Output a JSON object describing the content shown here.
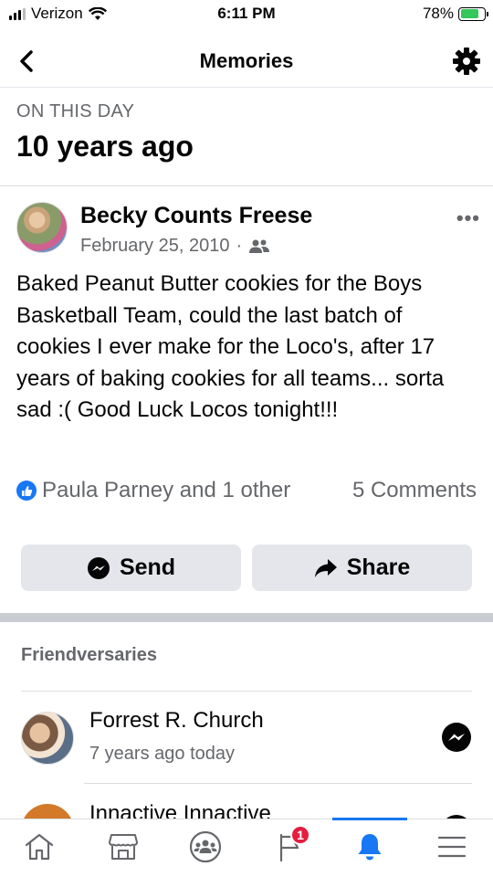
{
  "status_bar": {
    "carrier": "Verizon",
    "time": "6:11 PM",
    "battery": "78%"
  },
  "header": {
    "title": "Memories"
  },
  "on_this_day": {
    "label": "ON THIS DAY",
    "years_ago": "10 years ago"
  },
  "post": {
    "author": "Becky Counts Freese",
    "date": "February 25, 2010",
    "separator": "·",
    "text": "Baked Peanut Butter cookies for the Boys Basketball Team, could the last batch of cookies I ever make for the Loco's, after 17 years of baking cookies for all teams... sorta sad :( Good Luck Locos tonight!!!",
    "reactions_text": "Paula Parney and 1 other",
    "comments_text": "5 Comments",
    "send_label": "Send",
    "share_label": "Share"
  },
  "friendversaries": {
    "title": "Friendversaries",
    "items": [
      {
        "name": "Forrest R. Church",
        "subtitle": "7 years ago today"
      },
      {
        "name": "Innactive Innactive"
      }
    ]
  },
  "bottom_nav": {
    "groups_badge": "1",
    "active": "notifications"
  },
  "colors": {
    "accent": "#1877f2",
    "badge": "#e41e3f",
    "secondary_text": "#65676b"
  }
}
